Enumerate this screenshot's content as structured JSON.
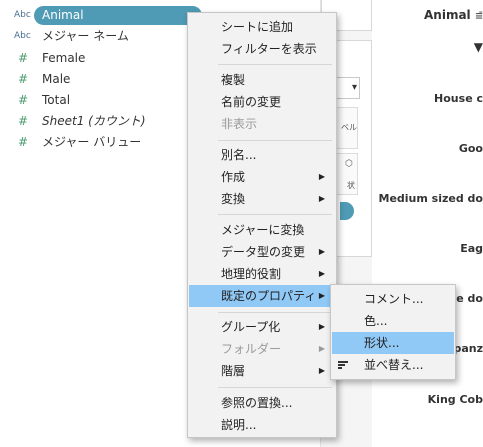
{
  "fields": [
    {
      "type": "Abc",
      "name": "Animal",
      "selected": true
    },
    {
      "type": "Abc",
      "name": "メジャー ネーム"
    },
    {
      "type": "#",
      "name": "Female"
    },
    {
      "type": "#",
      "name": "Male"
    },
    {
      "type": "#",
      "name": "Total"
    },
    {
      "type": "#",
      "name": "Sheet1 (カウント)",
      "italic": true
    },
    {
      "type": "#",
      "name": "メジャー バリュー"
    }
  ],
  "cards": {
    "dropdown_arrow": "▾",
    "mark_label_1": "ベル",
    "mark_label_2": "状"
  },
  "view": {
    "column_header": "Animal",
    "rows": [
      "House c",
      "Goo",
      "Medium sized do",
      "Eag",
      "ge do",
      "panz",
      "King Cob"
    ]
  },
  "context_menu": {
    "items": [
      {
        "label": "シートに追加"
      },
      {
        "label": "フィルターを表示"
      },
      {
        "label": "複製"
      },
      {
        "label": "名前の変更"
      },
      {
        "label": "非表示",
        "disabled": true
      },
      {
        "label": "別名..."
      },
      {
        "label": "作成",
        "submenu": true
      },
      {
        "label": "変換",
        "submenu": true
      },
      {
        "label": "メジャーに変換"
      },
      {
        "label": "データ型の変更",
        "submenu": true
      },
      {
        "label": "地理的役割",
        "submenu": true
      },
      {
        "label": "既定のプロパティ",
        "submenu": true,
        "highlighted": true
      },
      {
        "label": "グループ化",
        "submenu": true
      },
      {
        "label": "フォルダー",
        "submenu": true,
        "disabled": true
      },
      {
        "label": "階層",
        "submenu": true
      },
      {
        "label": "参照の置換..."
      },
      {
        "label": "説明..."
      }
    ]
  },
  "submenu": {
    "items": [
      {
        "label": "コメント..."
      },
      {
        "label": "色..."
      },
      {
        "label": "形状...",
        "highlighted": true
      },
      {
        "label": "並べ替え...",
        "icon": "sort-icon"
      }
    ]
  },
  "colors": {
    "menu_bg": "#f2f2f2",
    "highlight": "#90c8f6",
    "pill": "#4f9ab5",
    "measure_green": "#4a9b6e",
    "dimension_blue": "#4a6f90"
  }
}
